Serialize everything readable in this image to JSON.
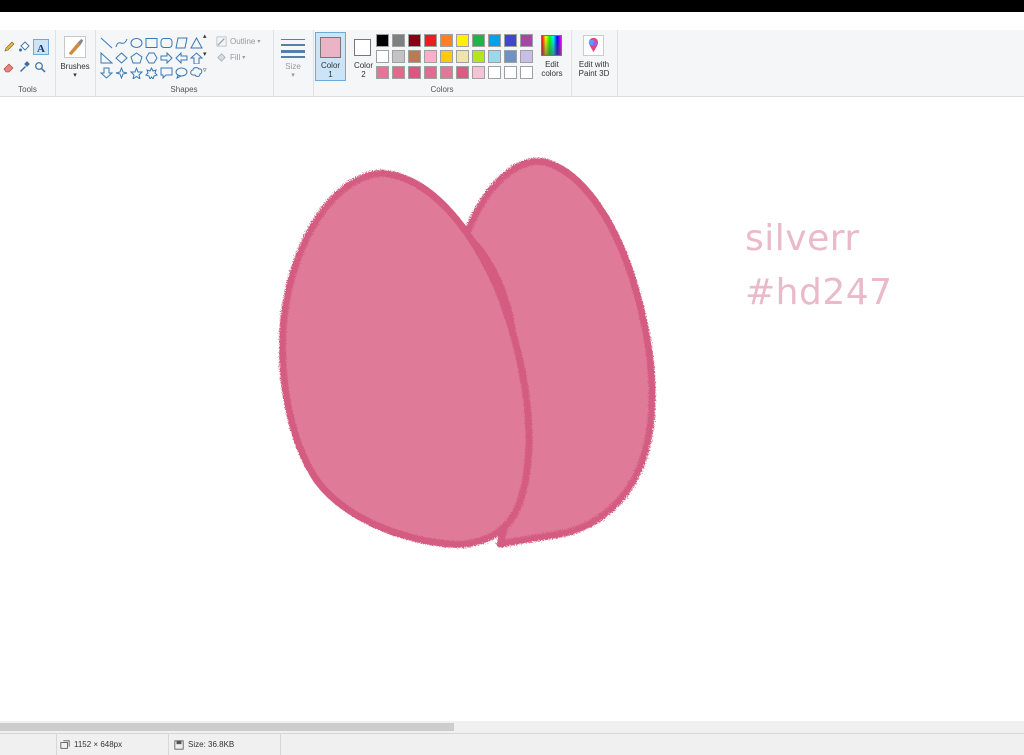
{
  "ribbon": {
    "tools": {
      "label": "Tools"
    },
    "brushes": {
      "label": "Brushes"
    },
    "shapes": {
      "label": "Shapes",
      "outline_label": "Outline",
      "fill_label": "Fill"
    },
    "size": {
      "label": "Size"
    },
    "colors": {
      "label": "Colors",
      "color1_line1": "Color",
      "color1_line2": "1",
      "color2_line1": "Color",
      "color2_line2": "2",
      "color1_value": "#eab4c6",
      "color2_value": "#ffffff",
      "edit_colors_line1": "Edit",
      "edit_colors_line2": "colors",
      "palette_row1": [
        "#000000",
        "#7f7f7f",
        "#880015",
        "#ed1c24",
        "#ff7f27",
        "#fff200",
        "#22b14c",
        "#00a2e8",
        "#3f48cc",
        "#a349a4"
      ],
      "palette_row2": [
        "#ffffff",
        "#c3c3c3",
        "#b97a57",
        "#ffaec9",
        "#ffc90e",
        "#efe4b0",
        "#b5e61d",
        "#99d9ea",
        "#7092be",
        "#c8bfe7"
      ],
      "palette_row3": [
        "#e27697",
        "#de6a8c",
        "#d95780",
        "#dc6f91",
        "#dd7a98",
        "#d95c82",
        "#f3c5d4",
        "#ffffff",
        "#ffffff",
        "#ffffff"
      ]
    },
    "paint3d": {
      "line1": "Edit with",
      "line2": "Paint 3D"
    }
  },
  "canvas": {
    "watermark_line1": "silverr",
    "watermark_line2": "#hd247",
    "petal_color": "#e07a99",
    "petal_edge_color": "#d45b81"
  },
  "status": {
    "dimensions": "1152 × 648px",
    "size": "Size: 36.8KB"
  },
  "icons": [
    "pencil-icon",
    "fill-icon",
    "text-icon",
    "eraser-icon",
    "color-picker-icon",
    "magnifier-icon",
    "brush-icon",
    "size-lines-icon",
    "resize-icon",
    "save-icon",
    "paint3d-icon",
    "edit-colors-icon"
  ]
}
